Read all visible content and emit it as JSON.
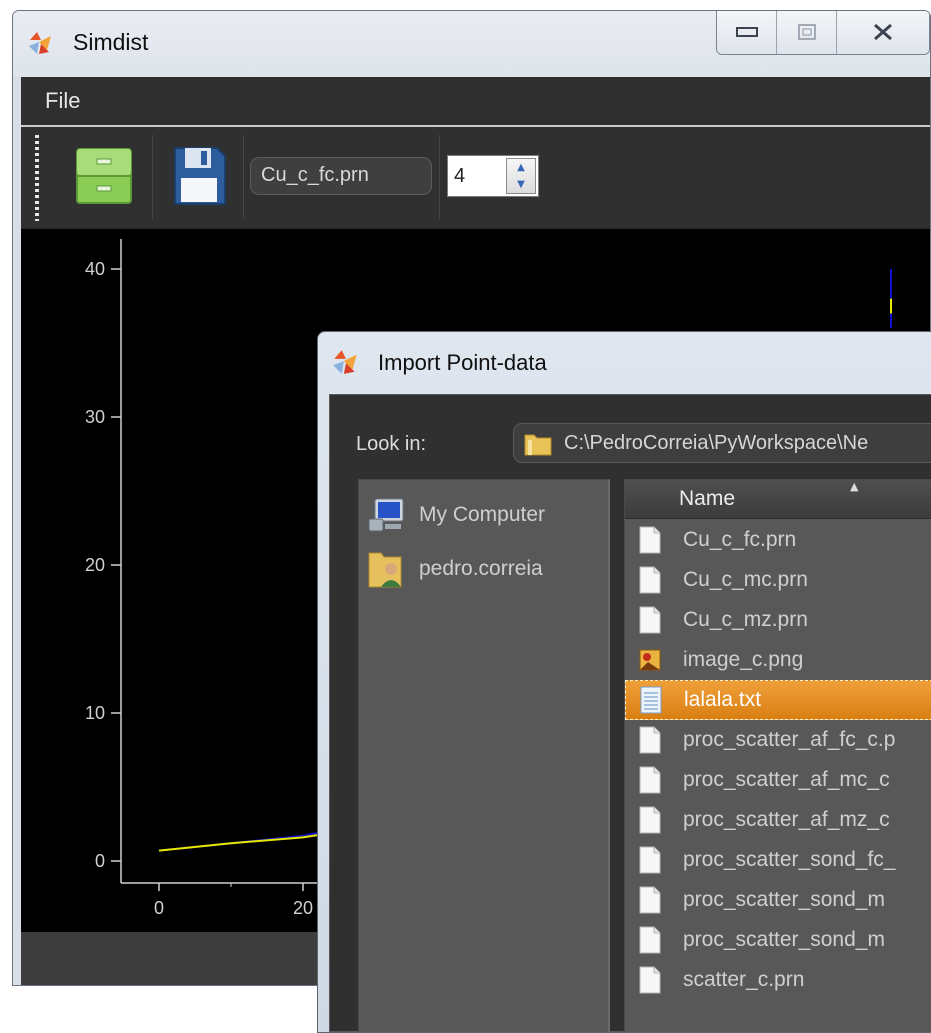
{
  "window": {
    "title": "Simdist",
    "menu": [
      "File"
    ],
    "caption_buttons": {
      "minimize": "▭",
      "maximize": "▢",
      "close": "✕"
    }
  },
  "toolbar": {
    "open_icon": "filing-cabinet-icon",
    "save_icon": "floppy-disk-icon",
    "file_combo_value": "Cu_c_fc.prn",
    "spin_value": "4"
  },
  "chart_data": {
    "type": "line",
    "title": "",
    "xlabel": "",
    "ylabel": "",
    "y_ticks": [
      "40",
      "30",
      "20",
      "10",
      "0"
    ],
    "x_ticks": [
      "0",
      "20"
    ],
    "ylim": [
      0,
      42
    ],
    "series": [
      {
        "color": "#1010d0",
        "points": [
          [
            0,
            0.7
          ],
          [
            10,
            1.2
          ],
          [
            20,
            1.7
          ],
          [
            24,
            2.1
          ]
        ]
      },
      {
        "color": "#e8e800",
        "points": [
          [
            0,
            0.7
          ],
          [
            10,
            1.2
          ],
          [
            20,
            1.6
          ],
          [
            24,
            1.9
          ]
        ]
      }
    ],
    "vertical_marker": {
      "x_note": "near right edge",
      "y_top": 40,
      "y_bottom": 36
    }
  },
  "dialog": {
    "title": "Import Point-data",
    "look_in_label": "Look in:",
    "path": "C:\\PedroCorreia\\PyWorkspace\\Ne",
    "sidebar": [
      {
        "label": "My Computer",
        "icon": "computer-icon"
      },
      {
        "label": "pedro.correia",
        "icon": "user-folder-icon"
      }
    ],
    "column_name": "Name",
    "files": [
      {
        "name": "Cu_c_fc.prn",
        "icon": "document-icon",
        "selected": false
      },
      {
        "name": "Cu_c_mc.prn",
        "icon": "document-icon",
        "selected": false
      },
      {
        "name": "Cu_c_mz.prn",
        "icon": "document-icon",
        "selected": false
      },
      {
        "name": "image_c.png",
        "icon": "image-icon",
        "selected": false
      },
      {
        "name": "lalala.txt",
        "icon": "text-file-icon",
        "selected": true
      },
      {
        "name": "proc_scatter_af_fc_c.p",
        "icon": "document-icon",
        "selected": false
      },
      {
        "name": "proc_scatter_af_mc_c",
        "icon": "document-icon",
        "selected": false
      },
      {
        "name": "proc_scatter_af_mz_c",
        "icon": "document-icon",
        "selected": false
      },
      {
        "name": "proc_scatter_sond_fc_",
        "icon": "document-icon",
        "selected": false
      },
      {
        "name": "proc_scatter_sond_m",
        "icon": "document-icon",
        "selected": false
      },
      {
        "name": "proc_scatter_sond_m",
        "icon": "document-icon",
        "selected": false
      },
      {
        "name": "scatter_c.prn",
        "icon": "document-icon",
        "selected": false
      }
    ]
  }
}
